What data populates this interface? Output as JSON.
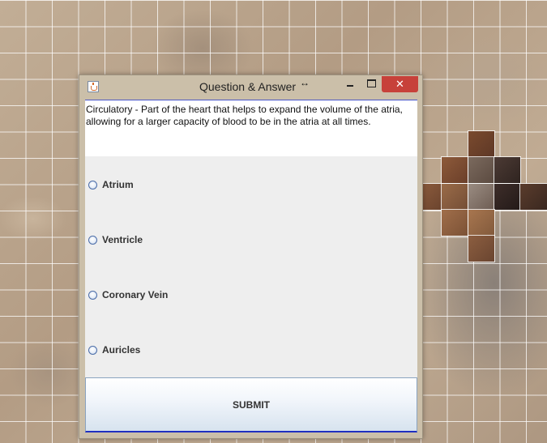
{
  "window": {
    "title": "Question & Answer",
    "close_glyph": "✕",
    "resize_cursor_glyph": "↔"
  },
  "question": {
    "text": "Circulatory - Part of the heart that helps to expand the volume of the atria, allowing for a larger capacity of blood to be in the atria at all times."
  },
  "options": [
    {
      "label": "Atrium",
      "selected": false
    },
    {
      "label": "Ventricle",
      "selected": false
    },
    {
      "label": "Coronary Vein",
      "selected": false
    },
    {
      "label": "Auricles",
      "selected": false
    }
  ],
  "submit_label": "SUBMIT",
  "colors": {
    "close_button": "#c7413a",
    "accent_border": "#1f2fc0"
  }
}
